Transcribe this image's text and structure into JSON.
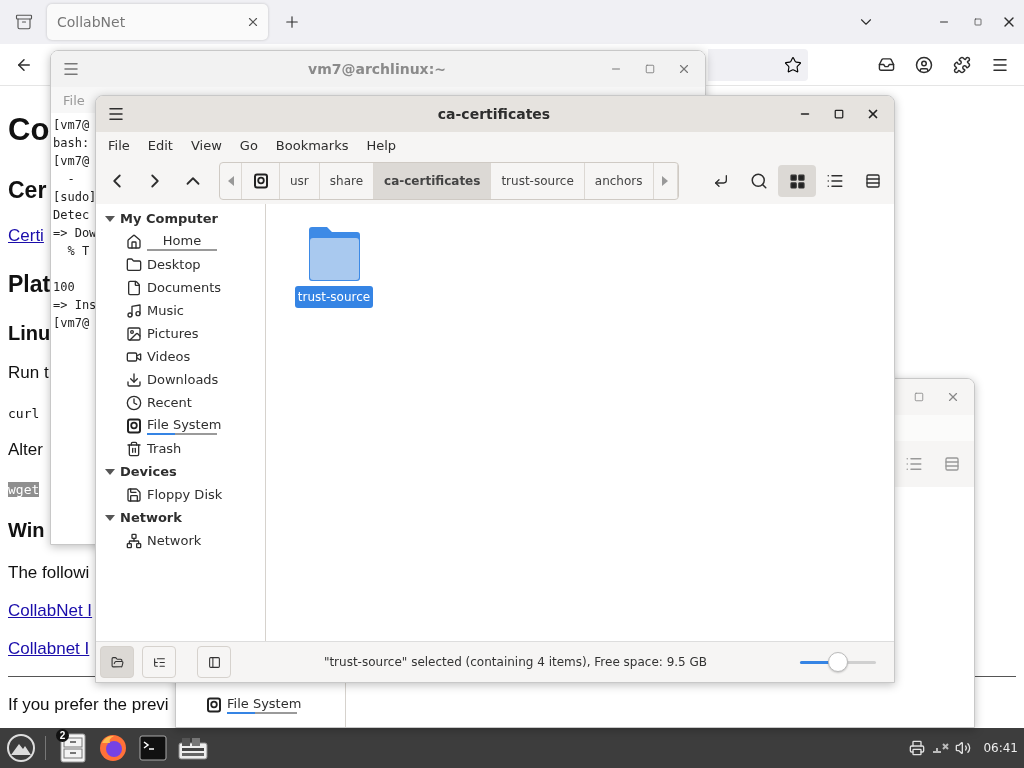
{
  "browser": {
    "tabs": [
      {
        "label": "CollabNet",
        "selected": true
      }
    ],
    "page": {
      "lines": [
        {
          "kind": "h1",
          "text": "Co",
          "selected": false
        },
        {
          "kind": "h2",
          "text": "Cer",
          "selected": false
        },
        {
          "kind": "link",
          "text": "Certi",
          "selected": false
        },
        {
          "kind": "h2",
          "text": "Plat",
          "selected": false
        },
        {
          "kind": "h3",
          "text": "Linu",
          "selected": false
        },
        {
          "kind": "p",
          "text": "Run t",
          "selected": false
        },
        {
          "kind": "code",
          "text": "curl",
          "selected": false
        },
        {
          "kind": "p",
          "text": "Alter",
          "selected": false
        },
        {
          "kind": "code",
          "text": "wget",
          "selected": true
        },
        {
          "kind": "h3",
          "text": "Win",
          "selected": false
        },
        {
          "kind": "p",
          "text": "The followi",
          "selected": false
        },
        {
          "kind": "link",
          "text": "CollabNet I",
          "selected": false
        },
        {
          "kind": "link",
          "text": "Collabnet I",
          "selected": false
        },
        {
          "kind": "p",
          "text": "If you prefer the previ",
          "selected": false
        }
      ]
    }
  },
  "terminal": {
    "title": "vm7@archlinux:~",
    "menu": [
      "File"
    ],
    "lines": [
      "[vm7@",
      "bash:",
      "[vm7@",
      "  -",
      "[sudo]",
      "Detec",
      "=> Dow",
      "  % T",
      "100",
      "=> Ins",
      "[vm7@"
    ]
  },
  "file_manager_back": {
    "sidebar": [
      {
        "label": "File System",
        "level": 0.4
      }
    ]
  },
  "file_manager": {
    "title": "ca-certificates",
    "menu": [
      "File",
      "Edit",
      "View",
      "Go",
      "Bookmarks",
      "Help"
    ],
    "path": [
      {
        "label": "usr",
        "selected": false
      },
      {
        "label": "share",
        "selected": false
      },
      {
        "label": "ca-certificates",
        "selected": true
      },
      {
        "label": "trust-source",
        "selected": false
      },
      {
        "label": "anchors",
        "selected": false
      }
    ],
    "views": [
      {
        "kind": "icons",
        "selected": true
      },
      {
        "kind": "list",
        "selected": false
      },
      {
        "kind": "compact",
        "selected": false
      }
    ],
    "sidebar": [
      {
        "label": "My Computer",
        "expanded": true,
        "children": [
          {
            "label": "Home",
            "kind": "home",
            "level": 0
          },
          {
            "label": "Desktop",
            "kind": "folder"
          },
          {
            "label": "Documents",
            "kind": "document"
          },
          {
            "label": "Music",
            "kind": "music"
          },
          {
            "label": "Pictures",
            "kind": "image"
          },
          {
            "label": "Videos",
            "kind": "video"
          },
          {
            "label": "Downloads",
            "kind": "download"
          },
          {
            "label": "Recent",
            "kind": "recent"
          },
          {
            "label": "File System",
            "kind": "drive",
            "level": 0.4
          },
          {
            "label": "Trash",
            "kind": "trash"
          }
        ]
      },
      {
        "label": "Devices",
        "expanded": true,
        "children": [
          {
            "label": "Floppy Disk",
            "kind": "floppy"
          }
        ]
      },
      {
        "label": "Network",
        "expanded": true,
        "children": [
          {
            "label": "Network",
            "kind": "network"
          }
        ]
      }
    ],
    "items": [
      {
        "name": "trust-source",
        "selected": true
      }
    ],
    "pane_buttons": [
      {
        "kind": "places",
        "selected": true
      },
      {
        "kind": "tree",
        "selected": false
      },
      {
        "kind": "toggle",
        "selected": false
      }
    ],
    "status": "\"trust-source\" selected (containing 4 items), Free space: 9.5 GB",
    "zoom": {
      "level": 0.5
    }
  },
  "taskbar": {
    "apps": [
      {
        "kind": "files",
        "badge": "2"
      },
      {
        "kind": "firefox"
      },
      {
        "kind": "terminal"
      },
      {
        "kind": "manager"
      }
    ],
    "clock": "06:41"
  }
}
